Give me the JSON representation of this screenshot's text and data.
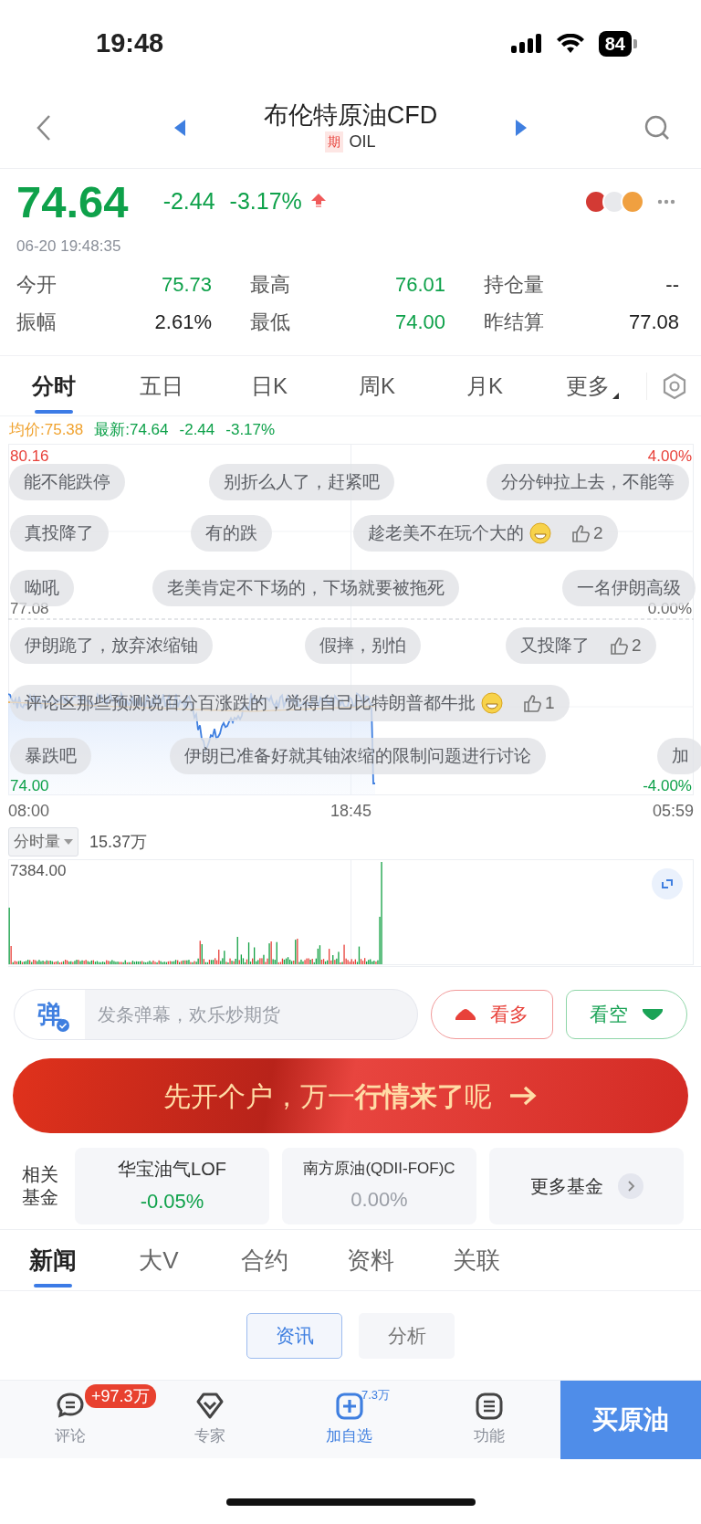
{
  "status_bar": {
    "time": "19:48",
    "battery": "84"
  },
  "header": {
    "title": "布伦特原油CFD",
    "tag": "期",
    "code": "OIL"
  },
  "quote": {
    "price": "74.64",
    "change": "-2.44",
    "change_pct": "-3.17%",
    "color": "#0ea14a",
    "timestamp": "06-20 19:48:35"
  },
  "stats": [
    {
      "label": "今开",
      "value": "75.73",
      "color": "#0ea14a"
    },
    {
      "label": "最高",
      "value": "76.01",
      "color": "#0ea14a"
    },
    {
      "label": "持仓量",
      "value": "--",
      "color": "#222222"
    },
    {
      "label": "振幅",
      "value": "2.61%",
      "color": "#222222"
    },
    {
      "label": "最低",
      "value": "74.00",
      "color": "#0ea14a"
    },
    {
      "label": "昨结算",
      "value": "77.08",
      "color": "#222222"
    }
  ],
  "period_tabs": [
    {
      "label": "分时",
      "selected": true,
      "kind": "tab"
    },
    {
      "label": "五日",
      "selected": false,
      "kind": "tab"
    },
    {
      "label": "日K",
      "selected": false,
      "kind": "tab"
    },
    {
      "label": "周K",
      "selected": false,
      "kind": "tab"
    },
    {
      "label": "月K",
      "selected": false,
      "kind": "tab"
    },
    {
      "label": "更多",
      "selected": false,
      "kind": "dropdown"
    }
  ],
  "legend": [
    {
      "text": "均价:75.38",
      "color": "#f0a22e"
    },
    {
      "text": "最新:74.64",
      "color": "#0ea14a"
    },
    {
      "text": "-2.44",
      "color": "#0ea14a"
    },
    {
      "text": "-3.17%",
      "color": "#0ea14a"
    }
  ],
  "chart": {
    "price_labels": [
      {
        "text": "80.16",
        "color": "#e8413a"
      },
      {
        "text": "77.08",
        "color": "#666666"
      },
      {
        "text": "74.00",
        "color": "#0ea14a"
      }
    ],
    "percent_labels": [
      {
        "text": "4.00%",
        "color": "#e8413a"
      },
      {
        "text": "0.00%",
        "color": "#666666"
      },
      {
        "text": "-4.00%",
        "color": "#0ea14a"
      }
    ],
    "time_labels": [
      "08:00",
      "18:45",
      "05:59"
    ]
  },
  "danmaku": [
    [
      {
        "text": "能不能跌停",
        "emoji": false
      },
      {
        "text": "别折么人了，赶紧吧",
        "emoji": false
      },
      {
        "text": "分分钟拉上去，不能等",
        "emoji": false
      }
    ],
    [
      {
        "text": "真投降了",
        "emoji": false
      },
      {
        "text": "有的跌",
        "emoji": false
      },
      {
        "text": "趁老美不在玩个大的",
        "emoji": true,
        "likes": "2"
      }
    ],
    [
      {
        "text": "呦吼",
        "emoji": false
      },
      {
        "text": "老美肯定不下场的，下场就要被拖死",
        "emoji": false
      },
      {
        "text": "一名伊朗高级",
        "emoji": false
      }
    ],
    [
      {
        "text": "伊朗跪了，放弃浓缩铀",
        "emoji": false
      },
      {
        "text": "假摔，别怕",
        "emoji": false
      },
      {
        "text": "又投降了",
        "emoji": false,
        "likes": "2"
      }
    ],
    [
      {
        "text": "评论区那些预测说百分百涨跌的，觉得自己比特朗普都牛批",
        "emoji": true,
        "likes": "1"
      }
    ],
    [
      {
        "text": "暴跌吧",
        "emoji": false
      },
      {
        "text": "伊朗已准备好就其铀浓缩的限制问题进行讨论",
        "emoji": false
      },
      {
        "text": "加",
        "emoji": false
      }
    ]
  ],
  "volume": {
    "selector": "分时量",
    "total": "15.37万",
    "max_label": "7384.00"
  },
  "comment_bar": {
    "badge": "弹",
    "placeholder": "发条弹幕，欢乐炒期货",
    "bull": "看多",
    "bear": "看空"
  },
  "banner": {
    "text": "先开个户，万一**行情来了**呢"
  },
  "funds": {
    "label": "相关基金",
    "items": [
      {
        "name": "华宝油气LOF",
        "change": "-0.05%",
        "color": "#0ea14a"
      },
      {
        "name": "南方原油(QDII-FOF)C",
        "change": "0.00%",
        "color": "#9a9ea6"
      }
    ],
    "more": "更多基金"
  },
  "news_tabs": [
    {
      "label": "新闻",
      "selected": true
    },
    {
      "label": "大V",
      "selected": false
    },
    {
      "label": "合约",
      "selected": false
    },
    {
      "label": "资料",
      "selected": false
    },
    {
      "label": "关联",
      "selected": false
    }
  ],
  "sub_tabs": [
    {
      "label": "资讯",
      "selected": true
    },
    {
      "label": "分析",
      "selected": false
    }
  ],
  "bottom_nav": {
    "items": [
      {
        "label": "评论",
        "kind": "comment",
        "active": false,
        "badge": "+97.3万"
      },
      {
        "label": "专家",
        "kind": "expert",
        "active": false
      },
      {
        "label": "加自选",
        "kind": "add",
        "active": true,
        "count": "7.3万"
      },
      {
        "label": "功能",
        "kind": "menu",
        "active": false
      }
    ],
    "buy": "买原油"
  }
}
